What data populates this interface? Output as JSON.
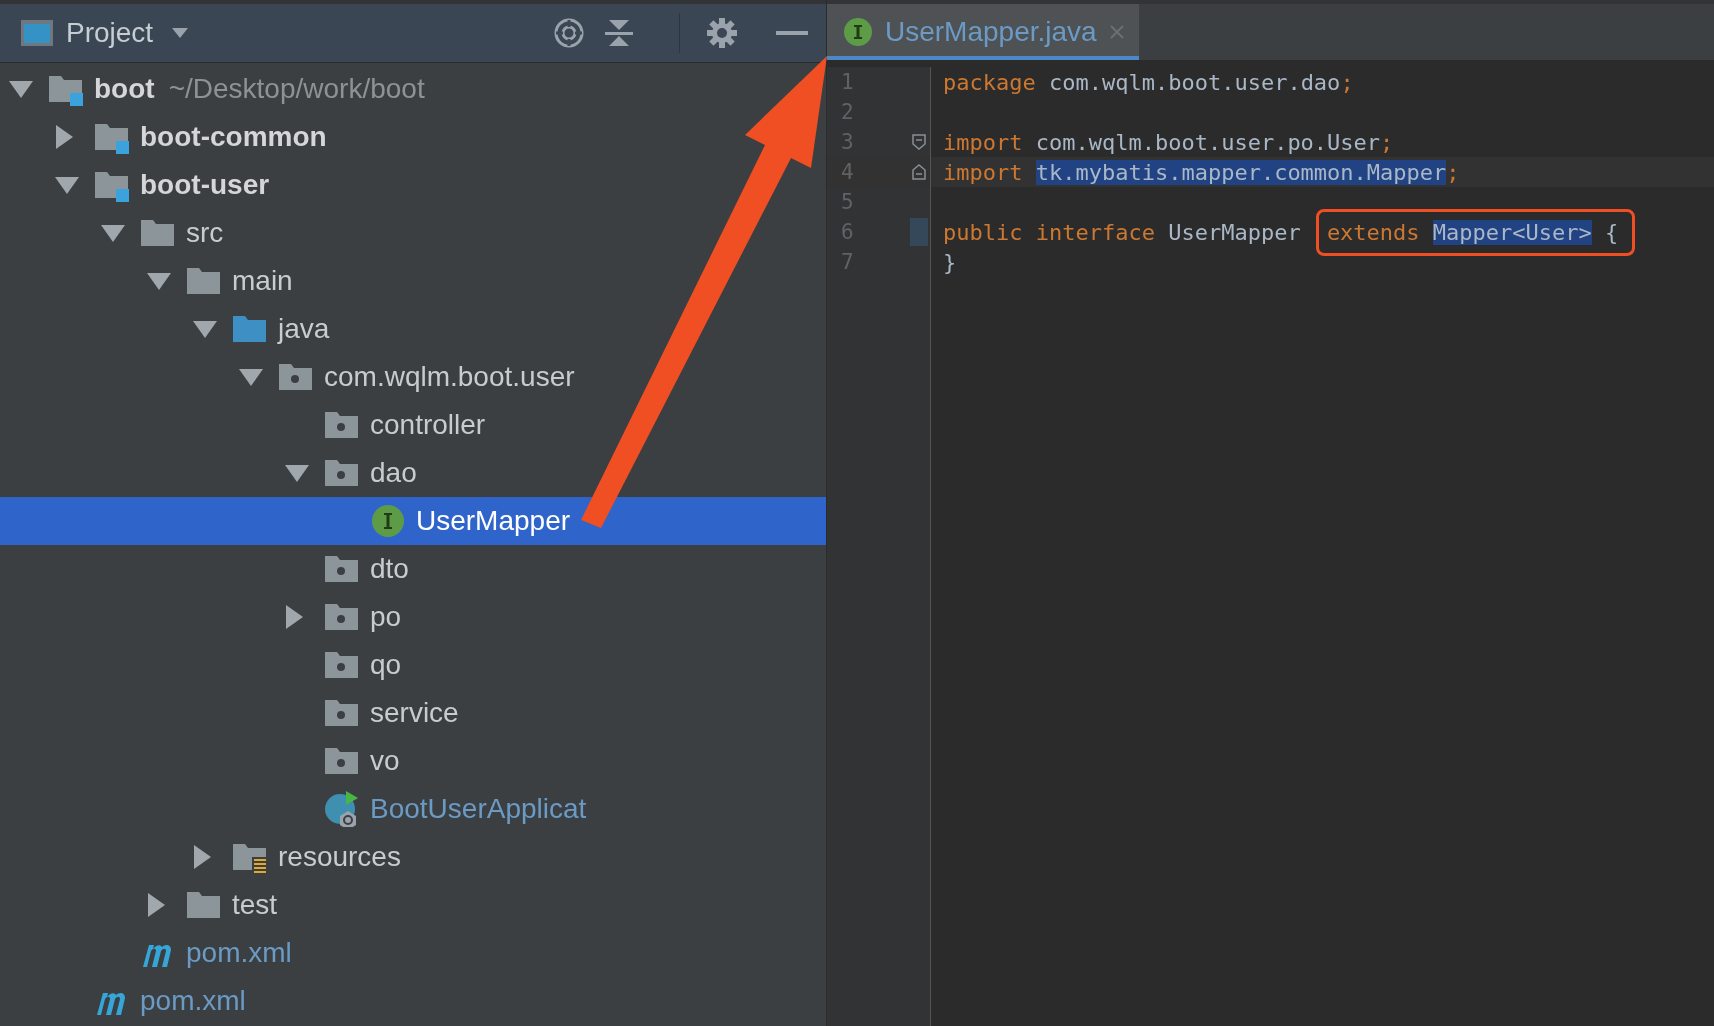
{
  "project_panel": {
    "title": "Project",
    "tree": [
      {
        "label": "boot",
        "path": "~/Desktop/work/boot",
        "kind": "module",
        "expanded": true,
        "selected": false,
        "children": [
          {
            "label": "boot-common",
            "kind": "module",
            "expanded": false,
            "selected": false
          },
          {
            "label": "boot-user",
            "kind": "module",
            "expanded": true,
            "selected": false,
            "children": [
              {
                "label": "src",
                "kind": "folder",
                "expanded": true,
                "selected": false,
                "children": [
                  {
                    "label": "main",
                    "kind": "folder",
                    "expanded": true,
                    "selected": false,
                    "children": [
                      {
                        "label": "java",
                        "kind": "source-folder",
                        "expanded": true,
                        "selected": false,
                        "children": [
                          {
                            "label": "com.wqlm.boot.user",
                            "kind": "package",
                            "expanded": true,
                            "selected": false,
                            "children": [
                              {
                                "label": "controller",
                                "kind": "package",
                                "selected": false
                              },
                              {
                                "label": "dao",
                                "kind": "package",
                                "expanded": true,
                                "selected": false,
                                "children": [
                                  {
                                    "label": "UserMapper",
                                    "kind": "interface",
                                    "selected": true
                                  }
                                ]
                              },
                              {
                                "label": "dto",
                                "kind": "package",
                                "selected": false
                              },
                              {
                                "label": "po",
                                "kind": "package",
                                "expanded": false,
                                "selected": false
                              },
                              {
                                "label": "qo",
                                "kind": "package",
                                "selected": false
                              },
                              {
                                "label": "service",
                                "kind": "package",
                                "selected": false
                              },
                              {
                                "label": "vo",
                                "kind": "package",
                                "selected": false
                              },
                              {
                                "label": "BootUserApplicat",
                                "kind": "spring-class",
                                "selected": false
                              }
                            ]
                          }
                        ]
                      },
                      {
                        "label": "resources",
                        "kind": "resources",
                        "expanded": false,
                        "selected": false
                      }
                    ]
                  },
                  {
                    "label": "test",
                    "kind": "folder",
                    "expanded": false,
                    "selected": false
                  }
                ]
              },
              {
                "label": "pom.xml",
                "kind": "maven",
                "selected": false
              }
            ]
          },
          {
            "label": "pom.xml",
            "kind": "maven",
            "selected": false
          }
        ]
      }
    ]
  },
  "editor": {
    "tab": {
      "title": "UserMapper.java",
      "selected": true
    },
    "lines": [
      {
        "number": "1",
        "tokens": [
          {
            "kind": "keyword",
            "text": "package "
          },
          {
            "kind": "plain",
            "text": "com.wqlm.boot.user.dao"
          },
          {
            "kind": "keyword",
            "text": ";"
          }
        ]
      },
      {
        "number": "2"
      },
      {
        "number": "3",
        "fold_start": true,
        "tokens": [
          {
            "kind": "keyword",
            "text": "import "
          },
          {
            "kind": "plain",
            "text": "com.wqlm.boot.user.po.User"
          },
          {
            "kind": "keyword",
            "text": ";"
          }
        ]
      },
      {
        "number": "4",
        "fold_end": true,
        "current": true,
        "tokens": [
          {
            "kind": "keyword",
            "text": "import "
          },
          {
            "kind": "selected",
            "text": "tk.mybatis.mapper.common.Mapper"
          },
          {
            "kind": "keyword",
            "text": ";"
          }
        ]
      },
      {
        "number": "5"
      },
      {
        "number": "6",
        "marker": true,
        "tokens": [
          {
            "kind": "keyword",
            "text": "public interface "
          },
          {
            "kind": "plain",
            "text": "UserMapper "
          },
          {
            "kind": "callout",
            "tokens": [
              {
                "kind": "keyword",
                "text": "extends "
              },
              {
                "kind": "selected",
                "text": "Mapper<User>"
              },
              {
                "kind": "plain",
                "text": " {"
              }
            ]
          }
        ]
      },
      {
        "number": "7",
        "tokens": [
          {
            "kind": "plain",
            "text": "}"
          }
        ]
      }
    ]
  }
}
